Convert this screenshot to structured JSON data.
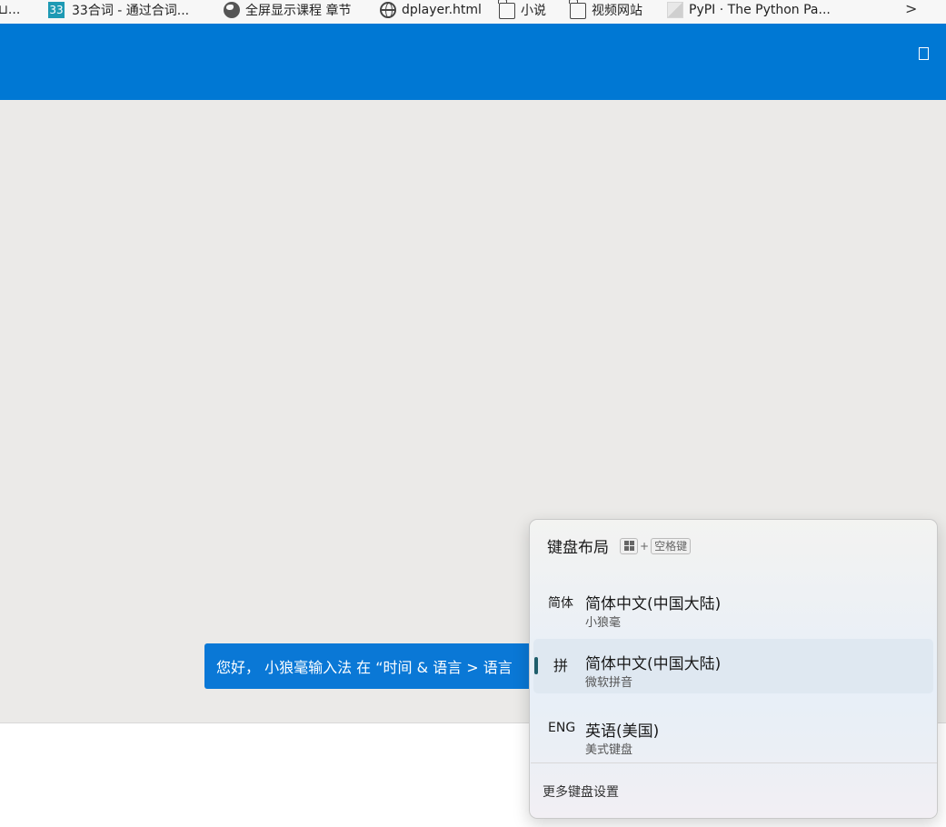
{
  "bookmarks": [
    {
      "icon": "partial-icon",
      "label": "⊔..."
    },
    {
      "icon": "number-badge-icon",
      "badge": "33",
      "label": "33合词 - 通过合词..."
    },
    {
      "icon": "world-icon",
      "label": "全屏显示课程 章节"
    },
    {
      "icon": "globe-icon",
      "label": "dplayer.html"
    },
    {
      "icon": "folder-icon",
      "label": "小说"
    },
    {
      "icon": "folder-icon",
      "label": "视频网站"
    },
    {
      "icon": "pypi-icon",
      "label": "PyPI · The Python Pa..."
    }
  ],
  "bookmarks_overflow": ">",
  "colors": {
    "titlebar": "#0078d4",
    "content_bg": "#ebeae8",
    "banner": "#0a78d6",
    "selected_item": "#dfe8f1",
    "selection_indicator": "#1f5e6b"
  },
  "banner": {
    "text": "您好， 小狼毫输入法 在 “时间 & 语言 > 语言"
  },
  "flyout": {
    "title": "键盘布局",
    "shortcut_plus": "+",
    "shortcut_key": "空格键",
    "items": [
      {
        "abbr": "简体",
        "name": "简体中文(中国大陆)",
        "sub": "小狼毫",
        "selected": false
      },
      {
        "abbr": "拼",
        "name": "简体中文(中国大陆)",
        "sub": "微软拼音",
        "selected": true
      },
      {
        "abbr": "ENG",
        "name": "英语(美国)",
        "sub": "美式键盘",
        "selected": false
      }
    ],
    "more_settings": "更多键盘设置"
  }
}
